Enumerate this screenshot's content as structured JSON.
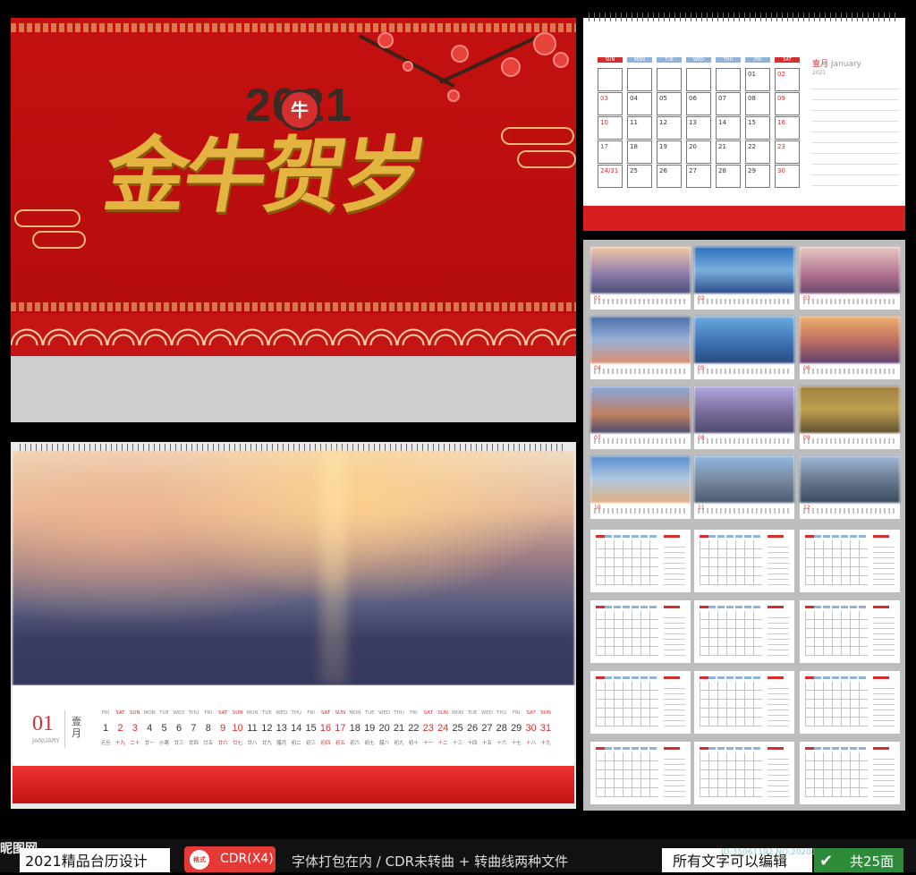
{
  "cover": {
    "year": "2021",
    "ox_char": "牛",
    "title": "金牛贺岁"
  },
  "january_calendar": {
    "weekdays": [
      "SUN",
      "MON",
      "TUE",
      "WED",
      "THU",
      "FRI",
      "SAT"
    ],
    "month_cn": "壹月",
    "month_en": "January",
    "year": "2021",
    "days": [
      [
        "",
        "",
        "",
        "",
        "",
        "01",
        "02"
      ],
      [
        "03",
        "04",
        "05",
        "06",
        "07",
        "08",
        "09"
      ],
      [
        "10",
        "11",
        "12",
        "13",
        "14",
        "15",
        "16"
      ],
      [
        "17",
        "18",
        "19",
        "20",
        "21",
        "22",
        "23"
      ],
      [
        "24/31",
        "25",
        "26",
        "27",
        "28",
        "29",
        "30"
      ]
    ]
  },
  "photo_calendar": {
    "month_num": "01",
    "month_en": "JANUARY",
    "month_cn": "壹月",
    "weekdays": [
      "FRI",
      "SAT",
      "SUN",
      "MON",
      "TUE",
      "WED",
      "THU",
      "FRI",
      "SAT",
      "SUN",
      "MON",
      "TUE",
      "WED",
      "THU",
      "FRI",
      "SAT",
      "SUN",
      "MON",
      "TUE",
      "WED",
      "THU",
      "FRI",
      "SAT",
      "SUN",
      "MON",
      "TUE",
      "WED",
      "THU",
      "FRI",
      "SAT",
      "SUN"
    ],
    "days": [
      "1",
      "2",
      "3",
      "4",
      "5",
      "6",
      "7",
      "8",
      "9",
      "10",
      "11",
      "12",
      "13",
      "14",
      "15",
      "16",
      "17",
      "18",
      "19",
      "20",
      "21",
      "22",
      "23",
      "24",
      "25",
      "26",
      "27",
      "28",
      "29",
      "30",
      "31"
    ],
    "lunar": [
      "元旦",
      "十九",
      "二十",
      "廿一",
      "小寒",
      "廿三",
      "廿四",
      "廿五",
      "廿六",
      "廿七",
      "廿八",
      "廿九",
      "腊月",
      "初二",
      "初三",
      "初四",
      "初五",
      "初六",
      "初七",
      "腊八",
      "初九",
      "初十",
      "十一",
      "十二",
      "十三",
      "十四",
      "十五",
      "十六",
      "十七",
      "十八",
      "十九"
    ]
  },
  "thumbnails": {
    "months": [
      "01",
      "02",
      "03",
      "04",
      "05",
      "06",
      "07",
      "08",
      "09",
      "10",
      "11",
      "12"
    ]
  },
  "footer": {
    "site": "昵图网",
    "title": "2021精品台历设计",
    "format_icon": "格式",
    "format": "CDR(X4)",
    "description": "字体打包在内 / CDR未转曲 + 转曲线两种文件",
    "editable": "所有文字可以编辑",
    "id": "ID:35061192 NO:20201102146577620851",
    "pages": "共25面"
  },
  "watermark": "www.nipic.com",
  "colors": {
    "red": "#c41111",
    "gold": "#e3b540",
    "green": "#2e8b3a"
  }
}
